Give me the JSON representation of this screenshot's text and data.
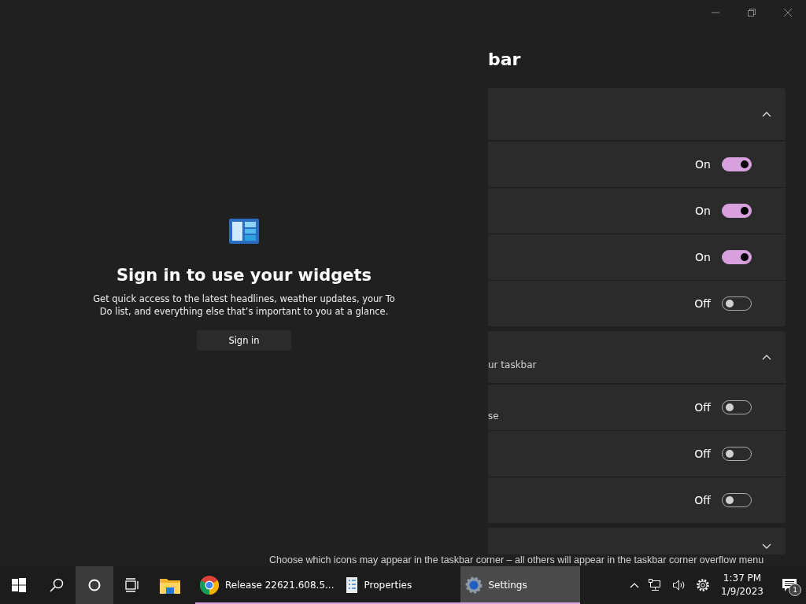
{
  "settings": {
    "title": "bar",
    "groups": [
      {
        "expanded": true,
        "rows": [
          {
            "state_label": "On",
            "on": true
          },
          {
            "state_label": "On",
            "on": true
          },
          {
            "state_label": "On",
            "on": true
          },
          {
            "state_label": "Off",
            "on": false
          }
        ]
      },
      {
        "expanded": true,
        "subtitle": "ur taskbar",
        "rows": [
          {
            "subtitle": "se",
            "state_label": "Off",
            "on": false
          },
          {
            "state_label": "Off",
            "on": false
          },
          {
            "state_label": "Off",
            "on": false
          }
        ]
      },
      {
        "expanded": false,
        "subtitle": "Choose which icons may appear in the taskbar corner – all others will appear in the taskbar corner overflow menu"
      }
    ]
  },
  "widgets": {
    "heading": "Sign in to use your widgets",
    "description": "Get quick access to the latest headlines, weather updates, your To Do list, and everything else that’s important to you at a glance.",
    "button": "Sign in"
  },
  "taskbar": {
    "apps": [
      {
        "kind": "start",
        "running": false,
        "selected": false
      },
      {
        "kind": "search",
        "running": false,
        "selected": false
      },
      {
        "kind": "cortana",
        "running": false,
        "selected": true
      },
      {
        "kind": "taskview",
        "running": false,
        "selected": false
      },
      {
        "kind": "explorer",
        "running": false,
        "selected": false
      },
      {
        "kind": "chrome",
        "label": "Release 22621.608.5...",
        "running": true,
        "selected": false
      },
      {
        "kind": "properties",
        "label": "Properties",
        "running": true,
        "selected": false
      },
      {
        "kind": "settings",
        "label": "Settings",
        "running": true,
        "selected": true
      }
    ],
    "time": "1:37 PM",
    "date": "1/9/2023",
    "notifications": "1"
  }
}
